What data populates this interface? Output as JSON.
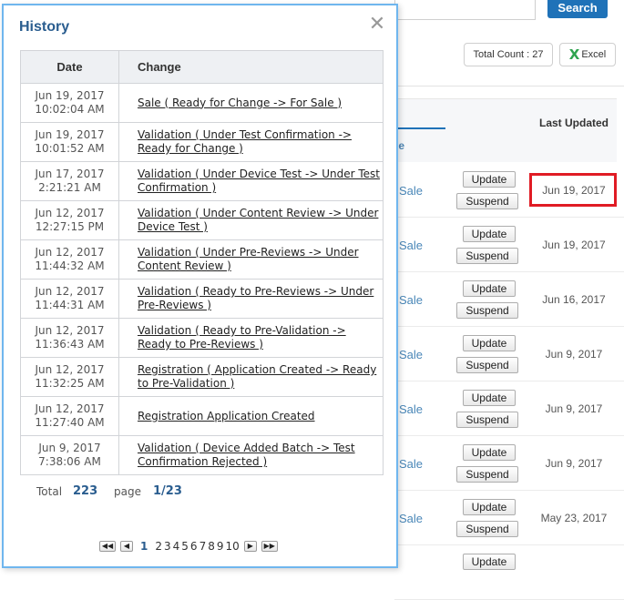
{
  "background": {
    "search_button": "Search",
    "total_count": "Total Count : 27",
    "excel_button": "Excel",
    "column_fragment": "le",
    "last_updated_header": "Last Updated",
    "update_label": "Update",
    "suspend_label": "Suspend",
    "rows": [
      {
        "status": "Sale",
        "last_updated": "Jun 19, 2017"
      },
      {
        "status": "Sale",
        "last_updated": "Jun 19, 2017"
      },
      {
        "status": "Sale",
        "last_updated": "Jun 16, 2017"
      },
      {
        "status": "Sale",
        "last_updated": "Jun 9, 2017"
      },
      {
        "status": "Sale",
        "last_updated": "Jun 9, 2017"
      },
      {
        "status": "Sale",
        "last_updated": "Jun 9, 2017"
      },
      {
        "status": "Sale",
        "last_updated": "May 23, 2017"
      },
      {
        "status": "",
        "last_updated": ""
      }
    ],
    "highlight_color": "#e01b24",
    "accent_color": "#1f72b8"
  },
  "modal": {
    "title": "History",
    "close_icon": "close-icon",
    "columns": {
      "date": "Date",
      "change": "Change"
    },
    "rows": [
      {
        "date_line1": "Jun 19, 2017",
        "date_line2": "10:02:04 AM",
        "change": "Sale ( Ready for Change -> For Sale )"
      },
      {
        "date_line1": "Jun 19, 2017",
        "date_line2": "10:01:52 AM",
        "change": "Validation ( Under Test Confirmation -> Ready for Change )"
      },
      {
        "date_line1": "Jun 17, 2017",
        "date_line2": "2:21:21 AM",
        "change": "Validation ( Under Device Test -> Under Test Confirmation )"
      },
      {
        "date_line1": "Jun 12, 2017",
        "date_line2": "12:27:15 PM",
        "change": "Validation ( Under Content Review -> Under Device Test )"
      },
      {
        "date_line1": "Jun 12, 2017",
        "date_line2": "11:44:32 AM",
        "change": "Validation ( Under Pre-Reviews -> Under Content Review )"
      },
      {
        "date_line1": "Jun 12, 2017",
        "date_line2": "11:44:31 AM",
        "change": "Validation ( Ready to Pre-Reviews -> Under Pre-Reviews )"
      },
      {
        "date_line1": "Jun 12, 2017",
        "date_line2": "11:36:43 AM",
        "change": "Validation ( Ready to Pre-Validation -> Ready to Pre-Reviews )"
      },
      {
        "date_line1": "Jun 12, 2017",
        "date_line2": "11:32:25 AM",
        "change": "Registration ( Application Created -> Ready to Pre-Validation )"
      },
      {
        "date_line1": "Jun 12, 2017",
        "date_line2": "11:27:40 AM",
        "change": "Registration Application Created"
      },
      {
        "date_line1": "Jun 9, 2017",
        "date_line2": "7:38:06 AM",
        "change": "Validation ( Device Added Batch -> Test Confirmation Rejected )"
      }
    ],
    "total_label": "Total",
    "total_value": "223",
    "page_label": "page",
    "page_value": "1/23",
    "pager": {
      "first": "◀◀",
      "prev": "◀",
      "next": "▶",
      "last": "▶▶",
      "current": "1",
      "pages": [
        "2",
        "3",
        "4",
        "5",
        "6",
        "7",
        "8",
        "9",
        "10"
      ]
    }
  }
}
